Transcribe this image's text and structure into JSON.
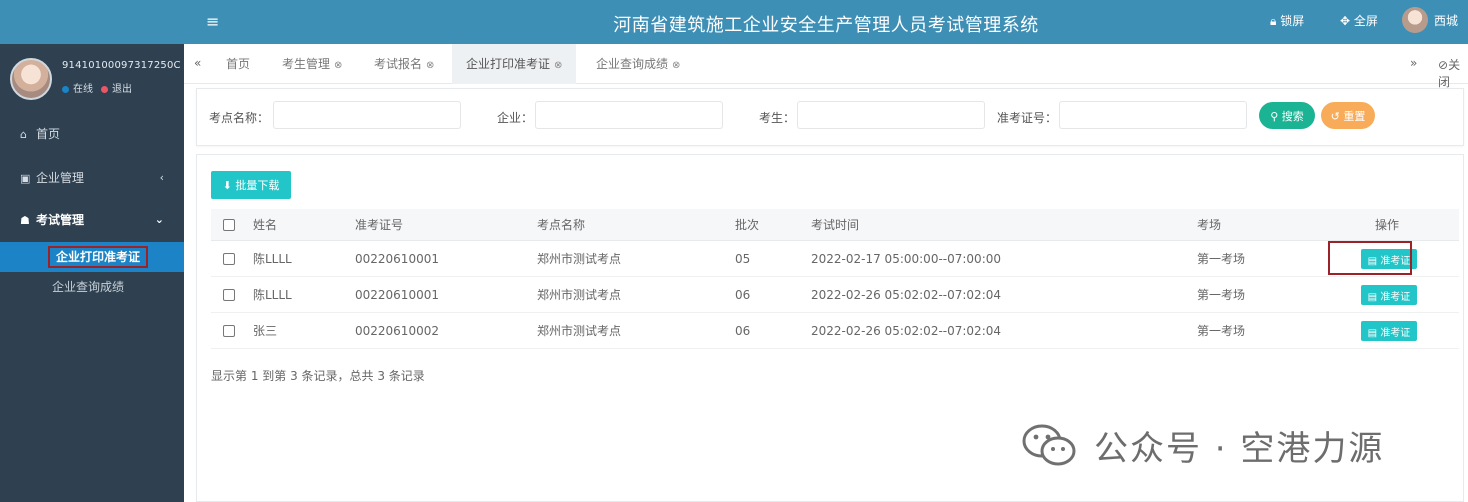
{
  "app": {
    "title": "河南省建筑施工企业安全生产管理人员考试管理系统",
    "lock_label": "锁屏",
    "fullscreen_label": "全屏",
    "user_label": "西城"
  },
  "sidebar": {
    "user_id": "91410100097317250C",
    "online_label": "在线",
    "logout_label": "退出",
    "items": [
      {
        "label": "首页",
        "icon": "home-icon"
      },
      {
        "label": "企业管理",
        "icon": "building-icon"
      },
      {
        "label": "考试管理",
        "icon": "graduation-cap-icon"
      }
    ],
    "sub_items": [
      {
        "label": "企业打印准考证",
        "active": true
      },
      {
        "label": "企业查询成绩",
        "active": false
      }
    ]
  },
  "tabs": {
    "items": [
      {
        "label": "首页",
        "closable": false
      },
      {
        "label": "考生管理",
        "closable": true
      },
      {
        "label": "考试报名",
        "closable": true
      },
      {
        "label": "企业打印准考证",
        "closable": true,
        "active": true
      },
      {
        "label": "企业查询成绩",
        "closable": true
      }
    ],
    "close_label": "关闭"
  },
  "search": {
    "fields": [
      {
        "label": "考点名称：",
        "value": ""
      },
      {
        "label": "企业：",
        "value": ""
      },
      {
        "label": "考生：",
        "value": ""
      },
      {
        "label": "准考证号：",
        "value": ""
      }
    ],
    "search_label": "搜索",
    "reset_label": "重置"
  },
  "table": {
    "batch_download_label": "批量下载",
    "columns": [
      "姓名",
      "准考证号",
      "考点名称",
      "批次",
      "考试时间",
      "考场",
      "操作"
    ],
    "rows": [
      {
        "name": "陈LLLL",
        "ticket": "00220610001",
        "site": "郑州市测试考点",
        "batch": "05",
        "time": "2022-02-17 05:00:00--07:00:00",
        "room": "第一考场",
        "action": "准考证"
      },
      {
        "name": "陈LLLL",
        "ticket": "00220610001",
        "site": "郑州市测试考点",
        "batch": "06",
        "time": "2022-02-26 05:02:02--07:02:04",
        "room": "第一考场",
        "action": "准考证"
      },
      {
        "name": "张三",
        "ticket": "00220610002",
        "site": "郑州市测试考点",
        "batch": "06",
        "time": "2022-02-26 05:02:02--07:02:04",
        "room": "第一考场",
        "action": "准考证"
      }
    ],
    "pager_text": "显示第 1 到第 3 条记录，总共 3 条记录"
  },
  "watermark": {
    "text": "公众号 · 空港力源"
  },
  "colors": {
    "header_blue": "#3d8fb5",
    "sidebar_dark": "#2f4050",
    "active_blue": "#1c84c6",
    "search_green": "#1ab394",
    "reset_orange": "#f8ac59",
    "cyan_button": "#23c6c8",
    "highlight_red": "#9b2226"
  }
}
